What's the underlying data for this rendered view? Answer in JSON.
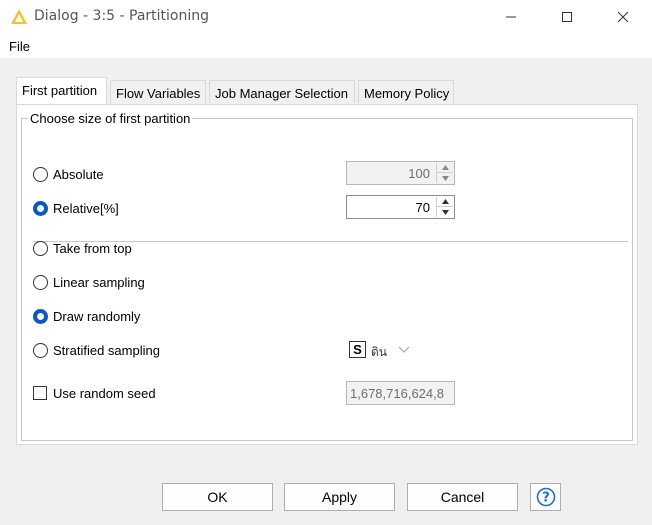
{
  "window": {
    "title": "Dialog - 3:5 - Partitioning",
    "icon": "warning-triangle-icon",
    "minimize_icon": "minimize-icon",
    "maximize_icon": "maximize-icon",
    "close_icon": "close-icon"
  },
  "menu": {
    "file": "File"
  },
  "tabs": [
    {
      "label": "First partition",
      "active": true
    },
    {
      "label": "Flow Variables",
      "active": false
    },
    {
      "label": "Job Manager Selection",
      "active": false
    },
    {
      "label": "Memory Policy",
      "active": false
    }
  ],
  "group": {
    "title": "Choose size of first partition",
    "absolute": {
      "label": "Absolute",
      "selected": false,
      "value": "100",
      "enabled": false
    },
    "relative": {
      "label": "Relative[%]",
      "selected": true,
      "value": "70",
      "enabled": true
    },
    "sampling": [
      {
        "label": "Take from top",
        "selected": false
      },
      {
        "label": "Linear sampling",
        "selected": false
      },
      {
        "label": "Draw randomly",
        "selected": true
      },
      {
        "label": "Stratified sampling",
        "selected": false
      }
    ],
    "stratified_column": {
      "type_badge": "S",
      "column_name": "ดิน"
    },
    "random_seed": {
      "label": "Use random seed",
      "checked": false,
      "value": "1,678,716,624,8"
    }
  },
  "buttons": {
    "ok": "OK",
    "apply": "Apply",
    "cancel": "Cancel",
    "help_icon": "help-icon"
  },
  "colors": {
    "accent": "#0a58c2",
    "logo_yellow": "#f4c32c"
  }
}
